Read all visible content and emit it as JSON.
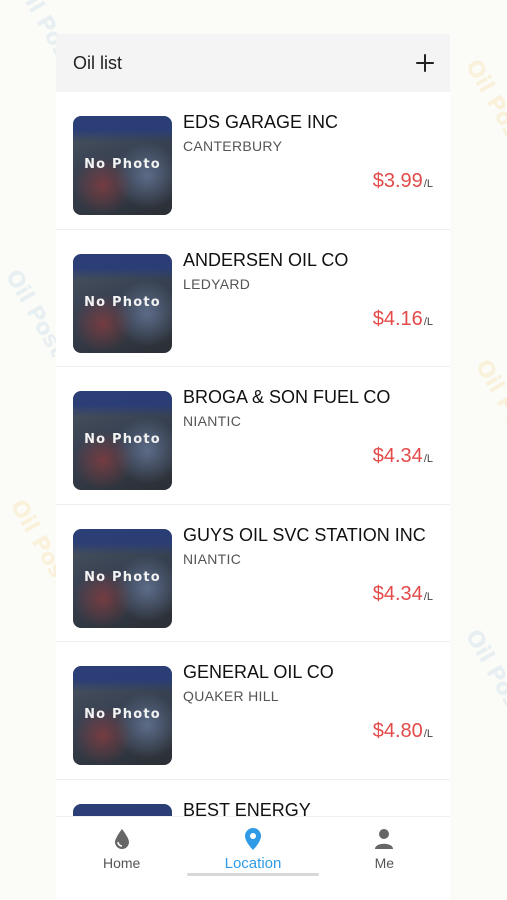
{
  "header": {
    "title": "Oil list",
    "add_icon": "plus-icon"
  },
  "stations": [
    {
      "name": "EDS GARAGE INC",
      "city": "CANTERBURY",
      "price": "$3.99",
      "unit": "/L",
      "photo": "No Photo"
    },
    {
      "name": "ANDERSEN OIL CO",
      "city": "LEDYARD",
      "price": "$4.16",
      "unit": "/L",
      "photo": "No Photo"
    },
    {
      "name": "BROGA & SON FUEL CO",
      "city": "NIANTIC",
      "price": "$4.34",
      "unit": "/L",
      "photo": "No Photo"
    },
    {
      "name": "GUYS OIL SVC STATION INC",
      "city": "NIANTIC",
      "price": "$4.34",
      "unit": "/L",
      "photo": "No Photo"
    },
    {
      "name": "GENERAL OIL CO",
      "city": "QUAKER HILL",
      "price": "$4.80",
      "unit": "/L",
      "photo": "No Photo"
    },
    {
      "name": "BEST ENERGY",
      "city": "",
      "price": "",
      "unit": "",
      "photo": ""
    }
  ],
  "tabs": [
    {
      "label": "Home",
      "icon": "drop-icon"
    },
    {
      "label": "Location",
      "icon": "location-pin-icon",
      "active": true
    },
    {
      "label": "Me",
      "icon": "person-icon"
    }
  ],
  "colors": {
    "price": "#e34a4a",
    "active_tab": "#2f9be6"
  }
}
